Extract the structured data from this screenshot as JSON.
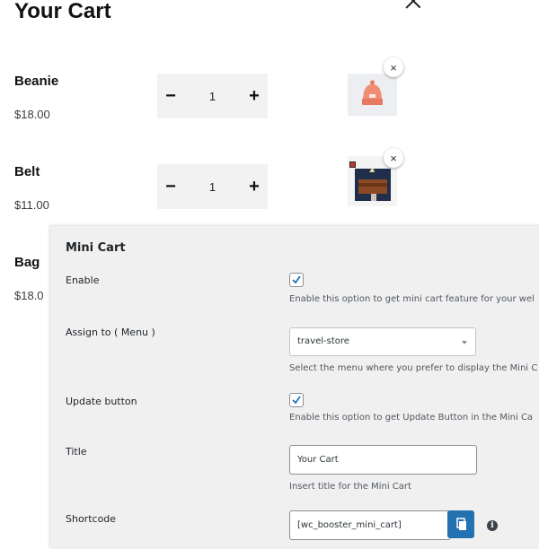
{
  "cart": {
    "title": "Your Cart",
    "items": [
      {
        "name": "Beanie",
        "price": "$18.00",
        "quantity": "1",
        "thumb_icon": "beanie-thumbnail"
      },
      {
        "name": "Belt",
        "price": "$11.00",
        "quantity": "1",
        "thumb_icon": "belt-thumbnail"
      },
      {
        "name": "Bag",
        "price": "$18.0"
      }
    ],
    "minus_glyph": "−",
    "plus_glyph": "+",
    "remove_glyph": "×"
  },
  "panel": {
    "title": "Mini Cart",
    "enable": {
      "label": "Enable",
      "checked": true,
      "description": "Enable this option to get mini cart feature for your wel"
    },
    "assign_menu": {
      "label": "Assign to ( Menu )",
      "value": "travel-store",
      "description": "Select the menu where you prefer to display the Mini C"
    },
    "update_button": {
      "label": "Update button",
      "checked": true,
      "description": "Enable this option to get Update Button in the Mini Ca"
    },
    "cart_title_setting": {
      "label": "Title",
      "value": "Your Cart",
      "description": "Insert title for the Mini Cart"
    },
    "shortcode": {
      "label": "Shortcode",
      "value": "[wc_booster_mini_cart]",
      "copy_icon": "copy-icon",
      "info_glyph": "i"
    }
  },
  "colors": {
    "accent": "#2271b1",
    "panel_bg": "#f0f0f1",
    "stepper_bg": "#f2f2f2"
  }
}
